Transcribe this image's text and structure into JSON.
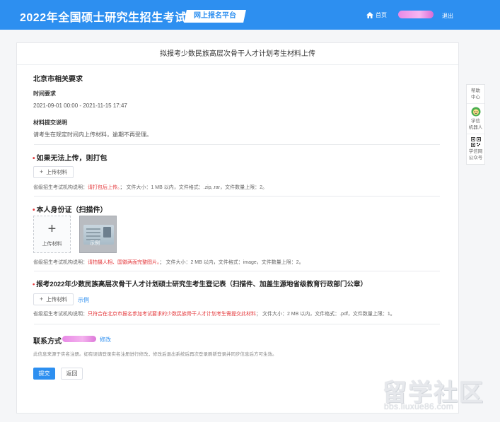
{
  "header": {
    "site_title": "2022年全国硕士研究生招生考试",
    "platform_tag": "网上报名平台",
    "home_label": "首页",
    "logout_label": "退出"
  },
  "page": {
    "title": "拟报考少数民族高层次骨干人才计划考生材料上传"
  },
  "requirements": {
    "section_title": "北京市相关要求",
    "time_title": "时间要求",
    "time_value": "2021-09-01 00:00 - 2021-11-15 17:47",
    "material_title": "材料提交说明",
    "material_value": "请考生在规定时间内上传材料，逾期不再受理。"
  },
  "upload_1": {
    "title": "如果无法上传，则打包",
    "button_label": "上传材料",
    "note_prefix": "省级招生考试机构说明：",
    "note_red": "请打包后上传。",
    "note_suffix": "；  文件大小：1 MB 以内，文件格式：.zip,.rar，文件数量上限：2。"
  },
  "upload_2": {
    "title": "本人身份证（扫描件）",
    "box_label": "上传材料",
    "thumb_label": "示例",
    "note_prefix": "省级招生考试机构说明：",
    "note_red": "请拍摄人相、国徽两面完整图片。",
    "note_suffix": "；  文件大小：2 MB 以内，文件格式：image，文件数量上限：2。"
  },
  "upload_3": {
    "title": "报考2022年少数民族高层次骨干人才计划硕士研究生考生登记表（扫描件、加盖生源地省级教育行政部门公章）",
    "button_label": "上传材料",
    "example_label": "示例",
    "note_prefix": "省级招生考试机构说明：",
    "note_red": "只符合在北京市报名参加考试要求的少数民族骨干人才计划考生需提交此材料",
    "note_suffix": "；  文件大小：2 MB 以内，文件格式：.pdf，文件数量上限：1。"
  },
  "contact": {
    "title": "联系方式",
    "edit_label": "修改",
    "note": "此信息来源于实名注册。如有误请登录实名注册进行修改，修改后退出系统后再次登录刷新登录并同步信息后方可生效。"
  },
  "actions": {
    "submit_label": "提交",
    "back_label": "返回"
  },
  "side_tools": {
    "help_label_1": "帮助",
    "help_label_2": "中心",
    "robot_label_1": "学信",
    "robot_label_2": "机器人",
    "qr_label_1": "学信网",
    "qr_label_2": "公众号"
  },
  "watermark": {
    "title": "留学社区",
    "url": "bbs.liuxue86.com"
  },
  "colors": {
    "primary": "#2d8ff0",
    "required_star": "#e4393c",
    "note_red": "#e4393c"
  }
}
